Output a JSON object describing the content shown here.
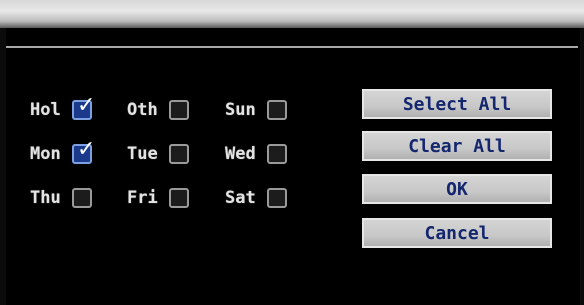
{
  "days": {
    "hol": {
      "label": "Hol",
      "checked": true
    },
    "oth": {
      "label": "Oth",
      "checked": false
    },
    "sun": {
      "label": "Sun",
      "checked": false
    },
    "mon": {
      "label": "Mon",
      "checked": true
    },
    "tue": {
      "label": "Tue",
      "checked": false
    },
    "wed": {
      "label": "Wed",
      "checked": false
    },
    "thu": {
      "label": "Thu",
      "checked": false
    },
    "fri": {
      "label": "Fri",
      "checked": false
    },
    "sat": {
      "label": "Sat",
      "checked": false
    }
  },
  "buttons": {
    "select_all": "Select All",
    "clear_all": "Clear All",
    "ok": "OK",
    "cancel": "Cancel"
  },
  "icons": {
    "checkmark": "checkmark-icon"
  },
  "colors": {
    "background": "#000000",
    "checked_fill": "#1b3a8c",
    "button_text": "#14266e",
    "label_text": "#e3e3e3"
  }
}
